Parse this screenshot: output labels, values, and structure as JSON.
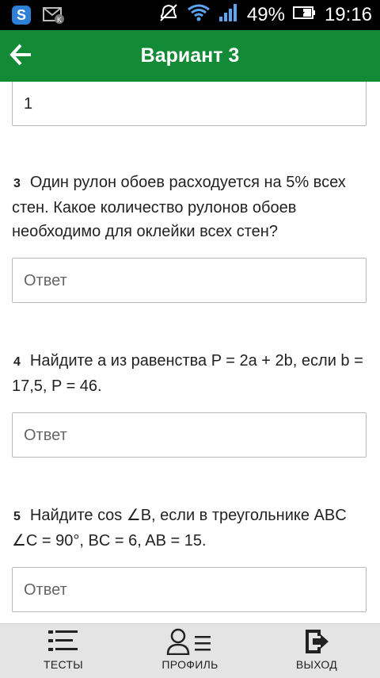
{
  "status_bar": {
    "battery_percent": "49%",
    "time": "19:16"
  },
  "app_bar": {
    "title": "Вариант 3"
  },
  "previous_answer": {
    "value": "1"
  },
  "questions": [
    {
      "number": "3",
      "text": "Один рулон обоев расходуется на 5% всех стен. Какое количество рулонов обоев необходимо для оклейки всех стен?",
      "answer_placeholder": "Ответ"
    },
    {
      "number": "4",
      "text": "Найдите a из равенства P = 2a + 2b, если b = 17,5, P = 46.",
      "answer_placeholder": "Ответ"
    },
    {
      "number": "5",
      "text": "Найдите cos ∠B, если в треугольнике ABC ∠C = 90°, BC = 6, AB = 15.",
      "answer_placeholder": "Ответ"
    }
  ],
  "bottom_nav": {
    "tests": "ТЕСТЫ",
    "profile": "ПРОФИЛЬ",
    "exit": "ВЫХОД"
  }
}
